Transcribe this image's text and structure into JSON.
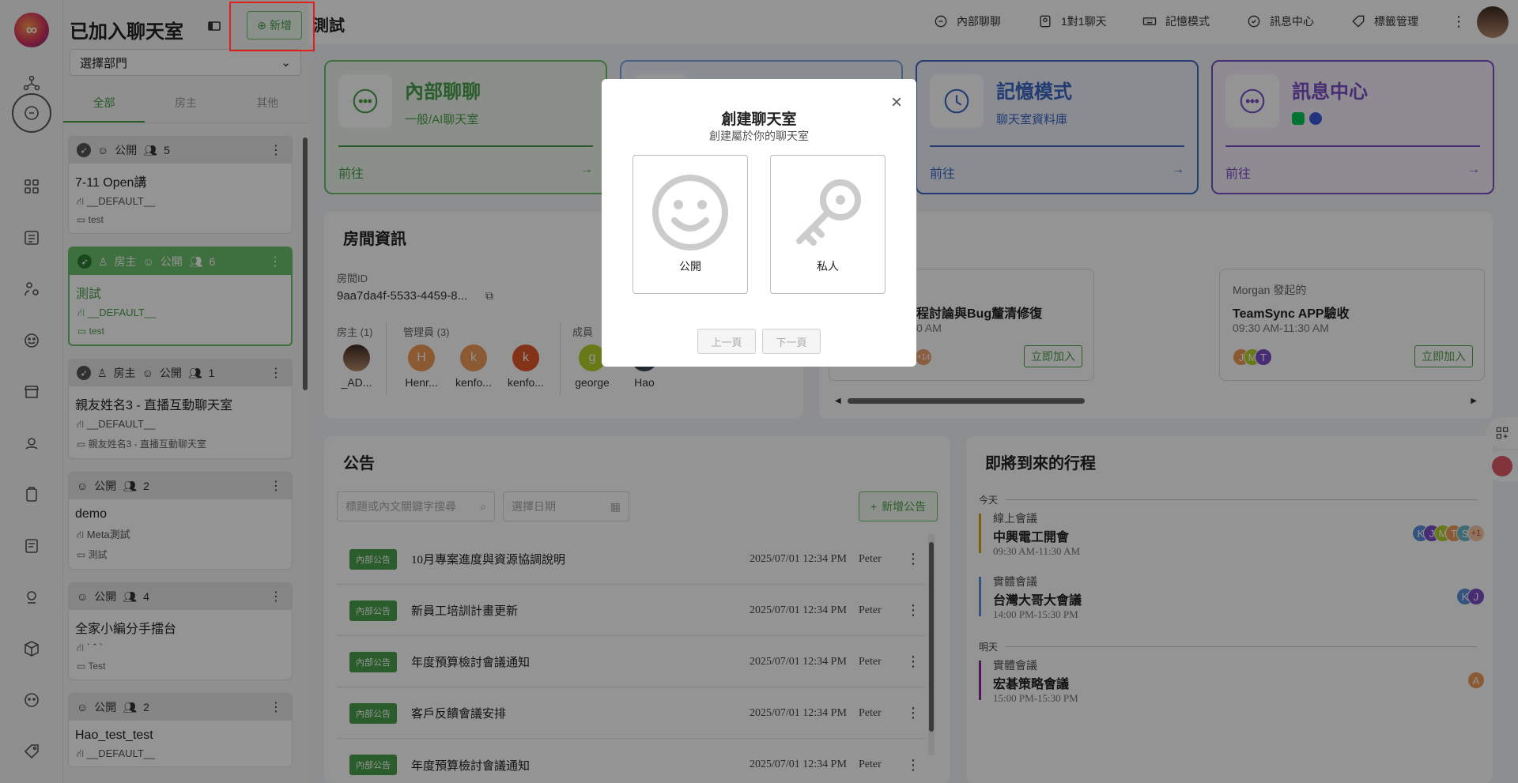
{
  "sidebar_panel": {
    "title": "已加入聊天室",
    "add_label": "新增",
    "dept_select": "選擇部門",
    "tabs": [
      "全部",
      "房主",
      "其他"
    ],
    "rooms": [
      {
        "visibility": "公開",
        "owner": "",
        "count": "5",
        "name": "7-11 Open講",
        "dept": "__DEFAULT__",
        "folder": "test"
      },
      {
        "visibility": "公開",
        "owner": "房主",
        "count": "6",
        "name": "測試",
        "dept": "__DEFAULT__",
        "folder": "test"
      },
      {
        "visibility": "公開",
        "owner": "房主",
        "count": "1",
        "name": "親友姓名3 - 直播互動聊天室",
        "dept": "__DEFAULT__",
        "folder": "親友姓名3 - 直播互動聊天室"
      },
      {
        "visibility": "公開",
        "owner": "",
        "count": "2",
        "name": "demo",
        "dept": "Meta測試",
        "folder": "測試"
      },
      {
        "visibility": "公開",
        "owner": "",
        "count": "4",
        "name": "全家小編分手擂台",
        "dept": "` ˆ `",
        "folder": "Test"
      },
      {
        "visibility": "公開",
        "owner": "",
        "count": "2",
        "name": "Hao_test_test",
        "dept": "__DEFAULT__",
        "folder": ""
      }
    ]
  },
  "topbar": {
    "room_title": "測試",
    "buttons": [
      "內部聊聊",
      "1對1聊天",
      "記憶模式",
      "訊息中心",
      "標籤管理"
    ]
  },
  "quick_cards": [
    {
      "title": "內部聊聊",
      "sub": "一般/AI聊天室",
      "go": "前往",
      "color": "#4b9f4b"
    },
    {
      "title": "",
      "sub": "",
      "go": "前往",
      "color": "#5b8fd9"
    },
    {
      "title": "記憶模式",
      "sub": "聊天室資料庫",
      "go": "前往",
      "color": "#3b67c4"
    },
    {
      "title": "訊息中心",
      "sub": "",
      "go": "前往",
      "color": "#7b4fc9"
    }
  ],
  "room_info": {
    "title": "房間資訊",
    "id_label": "房間ID",
    "id_value": "9aa7da4f-5533-4459-8...",
    "owner_label": "房主 (1)",
    "admin_label": "管理員 (3)",
    "member_label": "成員",
    "owner": [
      {
        "initial": "",
        "name": "_AD..."
      }
    ],
    "admins": [
      {
        "initial": "H",
        "name": "Henr..."
      },
      {
        "initial": "k",
        "name": "kenfo..."
      },
      {
        "initial": "k",
        "name": "kenfo..."
      }
    ],
    "members": [
      {
        "initial": "g",
        "name": "george"
      },
      {
        "initial": "",
        "name": "Hao"
      }
    ]
  },
  "events": [
    {
      "initiator": "",
      "title": "程討論與Bug釐清修復",
      "time": "0 AM",
      "more": "+14",
      "join": "立即加入"
    },
    {
      "initiator": "Morgan 發起的",
      "title": "TeamSync APP驗收",
      "time": "09:30 AM-11:30 AM",
      "avatars": [
        "J",
        "M",
        "T"
      ],
      "join": "立即加入"
    }
  ],
  "notice": {
    "title": "公告",
    "search_placeholder": "標題或內文關鍵字搜尋",
    "date_placeholder": "選擇日期",
    "add_label": "新增公告",
    "badge": "內部公告",
    "rows": [
      {
        "title": "10月專案進度與資源協調說明",
        "date": "2025/07/01 12:34 PM",
        "author": "Peter"
      },
      {
        "title": "新員工培訓計畫更新",
        "date": "2025/07/01 12:34 PM",
        "author": "Peter"
      },
      {
        "title": "年度預算檢討會議通知",
        "date": "2025/07/01 12:34 PM",
        "author": "Peter"
      },
      {
        "title": "客戶反饋會議安排",
        "date": "2025/07/01 12:34 PM",
        "author": "Peter"
      },
      {
        "title": "年度預算檢討會議通知",
        "date": "2025/07/01 12:34 PM",
        "author": "Peter"
      }
    ]
  },
  "schedule": {
    "title": "即將到來的行程",
    "today": "今天",
    "tomorrow": "明天",
    "items": [
      {
        "type": "線上會議",
        "title": "中興電工開會",
        "time": "09:30 AM-11:30 AM",
        "color": "#d4a514",
        "avatars": [
          "K",
          "J",
          "M",
          "T",
          "S"
        ],
        "more": "+1"
      },
      {
        "type": "實體會議",
        "title": "台灣大哥大會議",
        "time": "14:00 PM-15:30 PM",
        "color": "#5b8fd9",
        "avatars": [
          "K",
          "J"
        ]
      },
      {
        "type": "實體會議",
        "title": "宏碁策略會議",
        "time": "15:00 PM-15:30 PM",
        "color": "#8a2a9a",
        "avatars": [
          "A"
        ]
      }
    ]
  },
  "modal": {
    "title": "創建聊天室",
    "subtitle": "創建屬於你的聊天室",
    "option_public": "公開",
    "option_private": "私人",
    "prev": "上一頁",
    "next": "下一頁"
  }
}
